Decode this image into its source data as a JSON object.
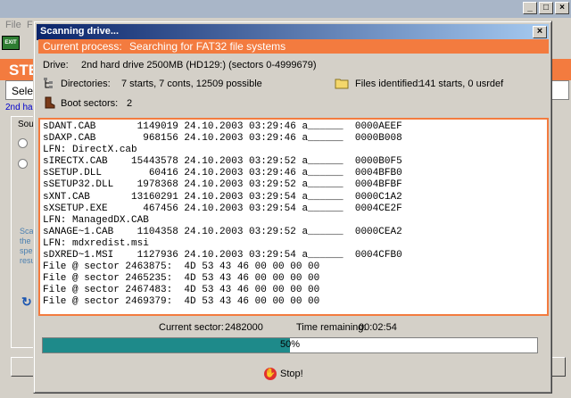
{
  "background_app": {
    "menu": [
      "File",
      "F"
    ],
    "toolbar_exit": "EXIT",
    "step_text": "STE",
    "select_text": "Selec",
    "link_text": "2nd ha",
    "group_label": "Sou",
    "side_text": [
      "Sca",
      "the",
      "spe",
      "resu"
    ]
  },
  "dialog": {
    "title": "Scanning drive...",
    "close_label": "×",
    "process_label": "Current process:",
    "process_value": "Searching for FAT32 file systems",
    "drive_label": "Drive:",
    "drive_value": "2nd hard drive 2500MB (HD129:) (sectors 0-4999679)",
    "directories_label": "Directories:",
    "directories_value": "7 starts, 7 conts, 12509 possible",
    "files_label": "Files identified:",
    "files_value": "141 starts, 0 usrdef",
    "boot_label": "Boot sectors:",
    "boot_value": "2",
    "log_lines": [
      "sDANT.CAB       1149019 24.10.2003 03:29:46 a______  0000AEEF",
      "sDAXP.CAB        968156 24.10.2003 03:29:46 a______  0000B008",
      "LFN: DirectX.cab",
      "sIRECTX.CAB    15443578 24.10.2003 03:29:52 a______  0000B0F5",
      "sSETUP.DLL        60416 24.10.2003 03:29:46 a______  0004BFB0",
      "sSETUP32.DLL    1978368 24.10.2003 03:29:52 a______  0004BFBF",
      "sXNT.CAB       13160291 24.10.2003 03:29:54 a______  0000C1A2",
      "sXSETUP.EXE      467456 24.10.2003 03:29:54 a______  0004CE2F",
      "LFN: ManagedDX.CAB",
      "sANAGE~1.CAB    1104358 24.10.2003 03:29:52 a______  0000CEA2",
      "LFN: mdxredist.msi",
      "sDXRED~1.MSI    1127936 24.10.2003 03:29:54 a______  0004CFB0",
      "File @ sector 2463875:  4D 53 43 46 00 00 00 00",
      "File @ sector 2465235:  4D 53 43 46 00 00 00 00",
      "File @ sector 2467483:  4D 53 43 46 00 00 00 00",
      "File @ sector 2469379:  4D 53 43 46 00 00 00 00"
    ],
    "current_sector_label": "Current sector:",
    "current_sector_value": "2482000",
    "time_remaining_label": "Time remaining:",
    "time_remaining_value": "00:02:54",
    "progress_percent": 50,
    "progress_text": "50%",
    "stop_label": "Stop!"
  },
  "colors": {
    "accent_orange": "#f37b3f",
    "progress_teal": "#1e8a8a",
    "title_blue": "#0a246a"
  }
}
